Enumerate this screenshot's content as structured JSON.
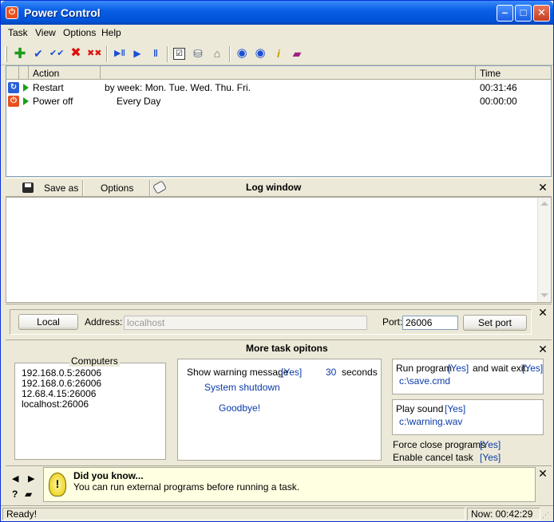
{
  "window": {
    "title": "Power Control"
  },
  "menu": [
    "Task",
    "View",
    "Options",
    "Help"
  ],
  "toolbar_icons": [
    "add-task-icon",
    "check-icon",
    "check-all-icon",
    "delete-icon",
    "delete-all-icon",
    "play-pause-icon",
    "play-icon",
    "pause-icon",
    "checklist-icon",
    "network-icon",
    "home-icon",
    "globe-left-icon",
    "globe-right-icon",
    "info-icon",
    "book-icon"
  ],
  "tasklist": {
    "columns": [
      "Action",
      "",
      "Time"
    ],
    "rows": [
      {
        "action": "Restart",
        "schedule": "by week: Mon. Tue. Wed. Thu. Fri.",
        "time": "00:31:46",
        "icon_color": "#2a5fd6",
        "icon_name": "restart-icon"
      },
      {
        "action": "Power off",
        "schedule": "Every Day",
        "time": "00:00:00",
        "icon_color": "#e8501e",
        "icon_name": "power-off-icon"
      }
    ]
  },
  "log": {
    "save_label": "Save as",
    "options_label": "Options",
    "title": "Log window"
  },
  "connection": {
    "local_label": "Local",
    "address_label": "Address:",
    "address_value": "localhost",
    "port_label": "Port:",
    "port_value": "26006",
    "set_port_label": "Set port"
  },
  "more": {
    "title": "More task opitons",
    "computers_label": "Computers",
    "computers": [
      "192.168.0.5:26006",
      "192.168.0.6:26006",
      "12.68.4.15:26006",
      "localhost:26006"
    ],
    "warning_label": "Show warning message",
    "warning_flag": "[Yes]",
    "warning_seconds": "30",
    "seconds_label": "seconds",
    "warning_msg1": "System shutdown",
    "warning_msg2": "Goodbye!",
    "run_label": "Run program",
    "run_flag": "[Yes]",
    "wait_label": "and wait exit.",
    "wait_flag": "[Yes]",
    "run_path": "c:\\save.cmd",
    "sound_label": "Play sound",
    "sound_flag": "[Yes]",
    "sound_path": "c:\\warning.wav",
    "force_label": "Force close programs",
    "force_flag": "[Yes]",
    "cancel_label": "Enable cancel task",
    "cancel_flag": "[Yes]"
  },
  "tip": {
    "title": "Did you know...",
    "text": "You can run external programs before running a task."
  },
  "status": {
    "left": "Ready!",
    "right": "Now: 00:42:29"
  }
}
